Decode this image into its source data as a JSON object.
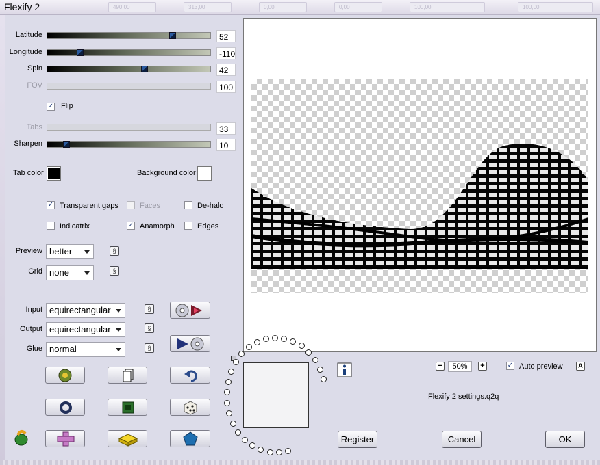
{
  "window": {
    "title": "Flexify 2",
    "ghost_fields": [
      "490,00",
      "313,00",
      "0,00",
      "0,00",
      "100,00",
      "100,00"
    ]
  },
  "sliders": [
    {
      "key": "latitude",
      "label": "Latitude",
      "value": "52",
      "fraction": 0.78,
      "enabled": true
    },
    {
      "key": "longitude",
      "label": "Longitude",
      "value": "-110",
      "fraction": 0.19,
      "enabled": true
    },
    {
      "key": "spin",
      "label": "Spin",
      "value": "42",
      "fraction": 0.6,
      "enabled": true
    },
    {
      "key": "fov",
      "label": "FOV",
      "value": "100",
      "fraction": 0,
      "enabled": false
    },
    {
      "key": "tabs",
      "label": "Tabs",
      "value": "33",
      "fraction": 0,
      "enabled": false
    },
    {
      "key": "sharpen",
      "label": "Sharpen",
      "value": "10",
      "fraction": 0.1,
      "enabled": true
    }
  ],
  "flip": {
    "label": "Flip",
    "checked": true
  },
  "colors": {
    "tab_color_label": "Tab color",
    "tab_color": "#000000",
    "background_color_label": "Background color",
    "background_color": "#ffffff",
    "accent_check": "#233c7b",
    "thumb": "#2b5a9e"
  },
  "options": {
    "transparent_gaps": {
      "label": "Transparent gaps",
      "checked": true,
      "enabled": true
    },
    "faces": {
      "label": "Faces",
      "checked": false,
      "enabled": false
    },
    "de_halo": {
      "label": "De-halo",
      "checked": false,
      "enabled": true
    },
    "indicatrix": {
      "label": "Indicatrix",
      "checked": false,
      "enabled": true
    },
    "anamorph": {
      "label": "Anamorph",
      "checked": true,
      "enabled": true
    },
    "edges": {
      "label": "Edges",
      "checked": false,
      "enabled": true
    }
  },
  "preview_select": {
    "label": "Preview",
    "value": "better"
  },
  "grid_select": {
    "label": "Grid",
    "value": "none"
  },
  "input_select": {
    "label": "Input",
    "value": "equirectangular"
  },
  "output_select": {
    "label": "Output",
    "value": "equirectangular"
  },
  "glue_select": {
    "label": "Glue",
    "value": "normal"
  },
  "icons": {
    "link": "link-icon",
    "input_projection": "disc-play-icon",
    "output_projection": "play-disc-icon",
    "randomize_flame": "flower-icon",
    "page": "page-icon",
    "undo": "undo-arrow-icon",
    "ring": "ring-icon",
    "square": "green-square-icon",
    "dice": "dice-icon",
    "lemming": "lemming-icon",
    "cross": "cross-icon",
    "brick": "lego-brick-icon",
    "pentagon": "pentagon-icon",
    "info": "info-icon"
  },
  "zoom": {
    "minus": "−",
    "value": "50%",
    "plus": "+"
  },
  "auto_preview": {
    "label": "Auto preview",
    "checked": true
  },
  "a_button": "A",
  "settings_file": "Flexify 2 settings.q2q",
  "buttons": {
    "register": "Register",
    "cancel": "Cancel",
    "ok": "OK"
  }
}
